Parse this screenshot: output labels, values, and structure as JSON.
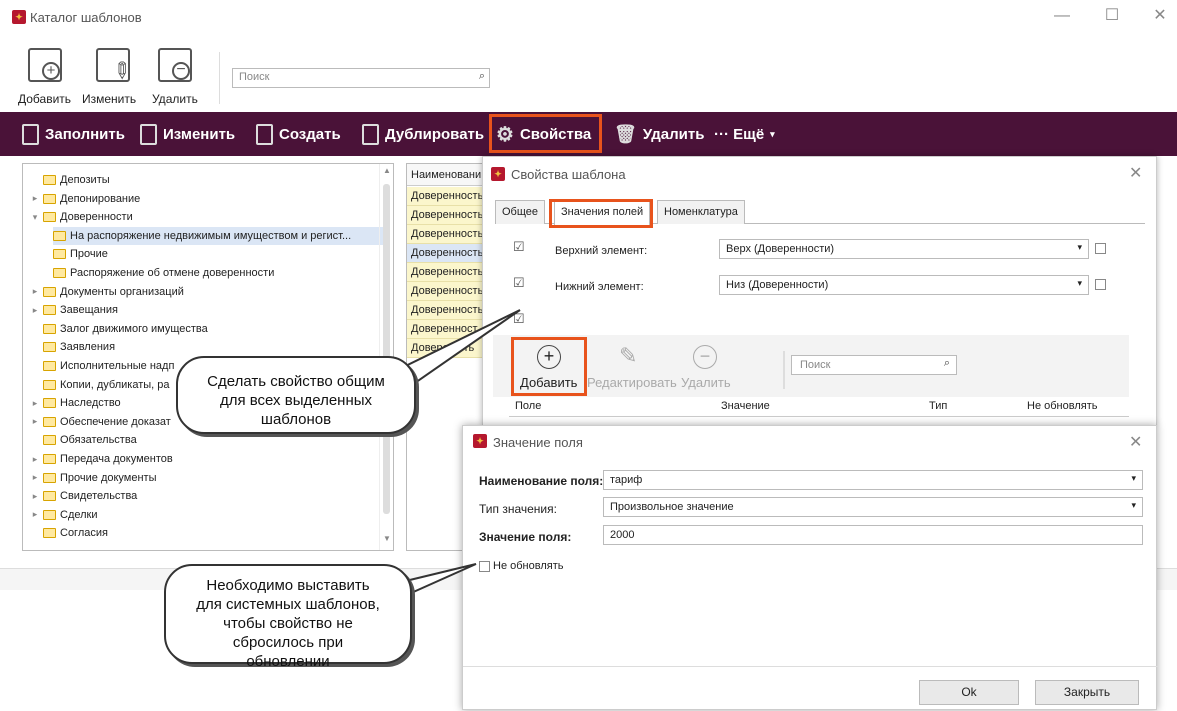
{
  "main_window": {
    "title": "Каталог шаблонов",
    "ribbon": {
      "add": "Добавить",
      "edit": "Изменить",
      "delete": "Удалить"
    },
    "search_placeholder": "Поиск",
    "toolbar": [
      "Заполнить",
      "Изменить",
      "Создать",
      "Дублировать",
      "Свойства",
      "Удалить",
      "··· Ещё"
    ]
  },
  "tree": [
    {
      "label": "Депозиты",
      "level": 0,
      "arrow": ""
    },
    {
      "label": "Депонирование",
      "level": 0,
      "arrow": "▸"
    },
    {
      "label": "Доверенности",
      "level": 0,
      "arrow": "▾"
    },
    {
      "label": "На распоряжение недвижимым имуществом и регист...",
      "level": 1,
      "arrow": "",
      "selected": true
    },
    {
      "label": "Прочие",
      "level": 1,
      "arrow": ""
    },
    {
      "label": "Распоряжение об отмене доверенности",
      "level": 1,
      "arrow": ""
    },
    {
      "label": "Документы организаций",
      "level": 0,
      "arrow": "▸"
    },
    {
      "label": "Завещания",
      "level": 0,
      "arrow": "▸"
    },
    {
      "label": "Залог движимого имущества",
      "level": 0,
      "arrow": ""
    },
    {
      "label": "Заявления",
      "level": 0,
      "arrow": ""
    },
    {
      "label": "Исполнительные надп",
      "level": 0,
      "arrow": ""
    },
    {
      "label": "Копии, дубликаты, ра",
      "level": 0,
      "arrow": ""
    },
    {
      "label": "Наследство",
      "level": 0,
      "arrow": "▸"
    },
    {
      "label": "Обеспечение доказат",
      "level": 0,
      "arrow": "▸"
    },
    {
      "label": "Обязательства",
      "level": 0,
      "arrow": ""
    },
    {
      "label": "Передача документов",
      "level": 0,
      "arrow": "▸"
    },
    {
      "label": "Прочие документы",
      "level": 0,
      "arrow": "▸"
    },
    {
      "label": "Свидетельства",
      "level": 0,
      "arrow": "▸"
    },
    {
      "label": "Сделки",
      "level": 0,
      "arrow": "▸"
    },
    {
      "label": "Согласия",
      "level": 0,
      "arrow": ""
    }
  ],
  "list": {
    "header": "Наименовани",
    "rows": [
      "Доверенность",
      "Доверенность",
      "Доверенность",
      "Доверенность",
      "Доверенность",
      "Доверенность",
      "Доверенность",
      "Доверенност",
      "Довере   ость"
    ]
  },
  "props_dialog": {
    "title": "Свойства шаблона",
    "tabs": [
      "Общее",
      "Значения полей",
      "Номенклатура"
    ],
    "upper_label": "Верхний элемент:",
    "upper_value": "Верх (Доверенности)",
    "lower_label": "Нижний элемент:",
    "lower_value": "Низ (Доверенности)",
    "add": "Добавить",
    "edit": "Редактировать",
    "delete": "Удалить",
    "search_placeholder": "Поиск",
    "columns": [
      "Поле",
      "Значение",
      "Тип",
      "Не обновлять"
    ]
  },
  "field_dialog": {
    "title": "Значение поля",
    "name_label": "Наименование поля:",
    "name_value": "тариф",
    "type_label": "Тип значения:",
    "type_value": "Произвольное значение",
    "value_label": "Значение поля:",
    "value_value": "2000",
    "no_update": "Не обновлять",
    "ok": "Ok",
    "close": "Закрыть"
  },
  "callouts": {
    "common": "Сделать свойство общим для всех выделенных шаблонов",
    "system": "Необходимо выставить для системных шаблонов, чтобы свойство не сбросилось при обновлении"
  },
  "colors": {
    "toolbar": "#4a1238",
    "highlight": "#e8531c",
    "selected": "#dbe6f5",
    "list_row": "#fbf6cc"
  }
}
